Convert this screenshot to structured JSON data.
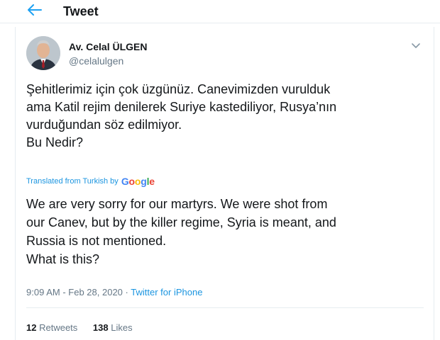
{
  "header": {
    "title": "Tweet",
    "back_icon": "arrow-left-icon"
  },
  "author": {
    "name": "Av. Celal ÜLGEN",
    "handle": "@celalulgen",
    "avatar_icon": "profile-photo"
  },
  "tweet": {
    "text": "Şehitlerimiz için çok üzgünüz. Canevimizden vurulduk\nama Katil rejim denilerek Suriye kastediliyor, Rusya’nın\nvurduğundan söz edilmiyor.\nBu Nedir?",
    "translated_label": "Translated from Turkish by",
    "translator": "Google",
    "translated_text": "We are very sorry for our martyrs. We were shot from\nour Canev, but by the killer regime, Syria is meant, and\nRussia is not mentioned.\n What is this?",
    "time": "9:09 AM",
    "date": "Feb 28, 2020",
    "separator": "·",
    "source": "Twitter for iPhone"
  },
  "stats": {
    "retweets_count": "12",
    "retweets_label": "Retweets",
    "likes_count": "138",
    "likes_label": "Likes"
  },
  "colors": {
    "accent": "#1b95e0",
    "text": "#14171a",
    "muted": "#657786",
    "border": "#e6ecf0"
  }
}
